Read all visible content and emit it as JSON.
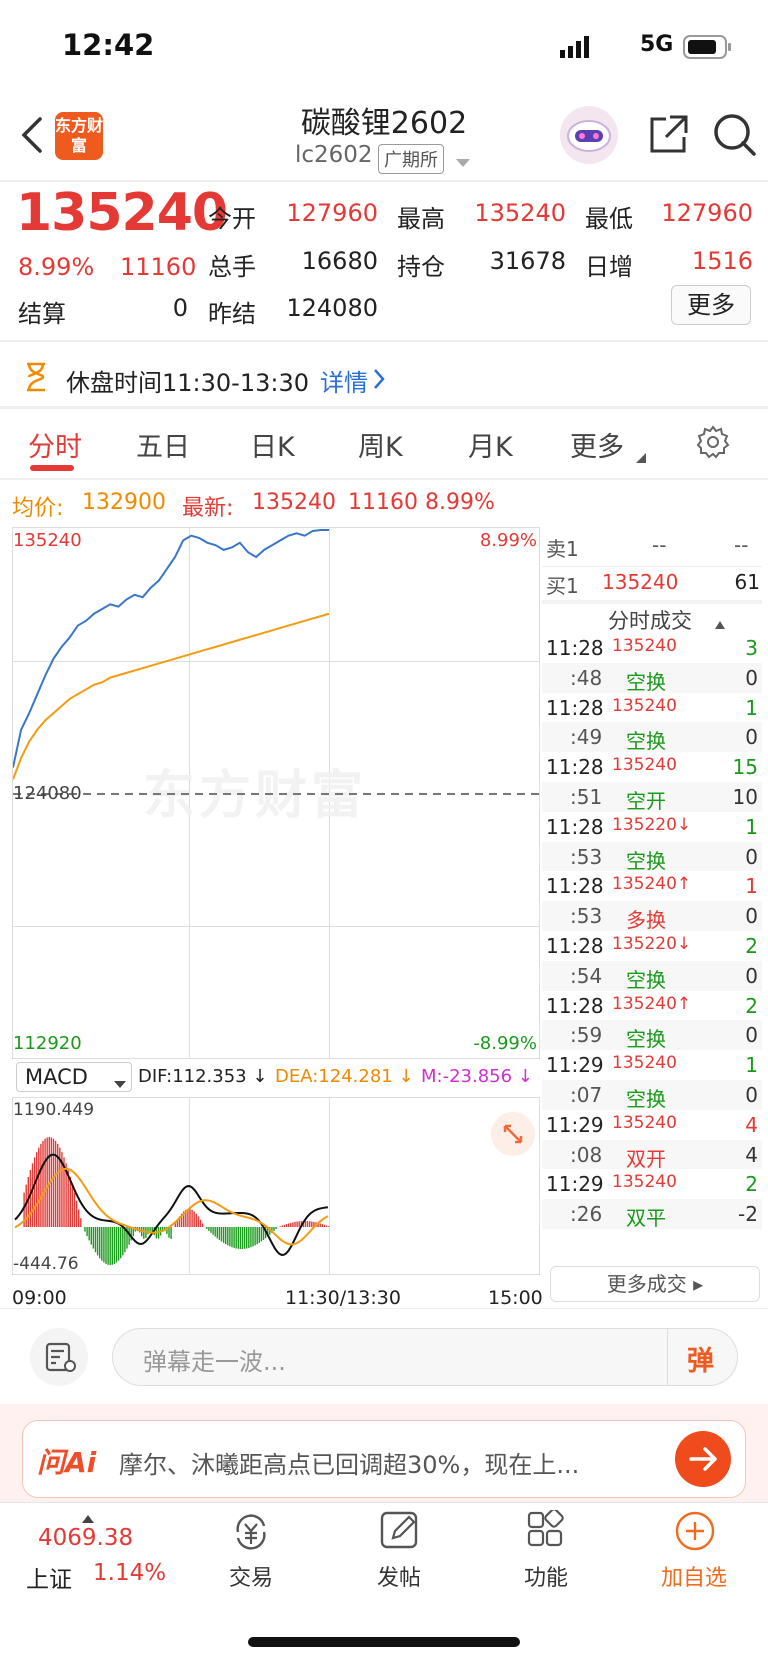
{
  "status_bar": {
    "time": "12:42",
    "network": "5G"
  },
  "header": {
    "title": "碳酸锂2602",
    "code": "lc2602",
    "exchange": "广期所",
    "logo_text": "东方财富"
  },
  "quote": {
    "last": "135240",
    "change_pct": "8.99%",
    "change": "11160",
    "labels": {
      "open": "今开",
      "high": "最高",
      "low": "最低",
      "volume": "总手",
      "oi": "持仓",
      "daily_add": "日增",
      "settle": "结算",
      "pre_settle": "昨结"
    },
    "open": "127960",
    "high": "135240",
    "low": "127960",
    "volume": "16680",
    "oi": "31678",
    "daily_add": "1516",
    "settle": "0",
    "pre_settle": "124080",
    "more": "更多"
  },
  "notice": {
    "text": "休盘时间11:30-13:30",
    "link": "详情"
  },
  "tabs": [
    "分时",
    "五日",
    "日K",
    "周K",
    "月K",
    "更多"
  ],
  "info_line": {
    "avg_label": "均价:",
    "avg": "132900",
    "last_label": "最新:",
    "last": "135240",
    "chg": "11160",
    "pct": "8.99%"
  },
  "chart_data": {
    "type": "line",
    "axis_high": "135240",
    "axis_low": "112920",
    "axis_mid": "124080",
    "pct_high": "8.99%",
    "pct_low": "-8.99%",
    "x_labels": [
      "09:00",
      "11:30/13:30",
      "15:00"
    ],
    "ylim": [
      112920,
      135240
    ],
    "series": [
      {
        "color": "#3a76c8",
        "values": [
          125200,
          126800,
          127500,
          128300,
          129100,
          129800,
          130300,
          130700,
          131200,
          131400,
          131700,
          131900,
          132100,
          132000,
          132300,
          132500,
          132400,
          132800,
          133100,
          133600,
          134100,
          134800,
          135000,
          134900,
          134700,
          134600,
          134400,
          134500,
          134700,
          134300,
          134100,
          134400,
          134600,
          134800,
          135000,
          135100,
          135000,
          135200,
          135240,
          135240
        ]
      },
      {
        "color": "#f39c12",
        "values": [
          124700,
          125600,
          126300,
          126800,
          127200,
          127500,
          127800,
          128100,
          128300,
          128500,
          128700,
          128800,
          129000,
          129100,
          129200,
          129300,
          129400,
          129500,
          129600,
          129700,
          129800,
          129900,
          130000,
          130100,
          130200,
          130300,
          130400,
          130500,
          130600,
          130700,
          130800,
          130900,
          131000,
          131100,
          131200,
          131300,
          131400,
          131500,
          131600,
          131700
        ]
      }
    ]
  },
  "macd": {
    "label": "MACD",
    "dif": "DIF:112.353 ↓",
    "dea": "DEA:124.281 ↓",
    "m": "M:-23.856 ↓",
    "top": "1190.449",
    "bottom": "-444.76"
  },
  "orderbook": {
    "sell_label": "卖1",
    "sell_price": "--",
    "sell_vol": "--",
    "buy_label": "买1",
    "buy_price": "135240",
    "buy_vol": "61"
  },
  "ticks_title": "分时成交",
  "ticks": [
    {
      "t": "11:28",
      "p": "135240",
      "v": "3",
      "pc": "red",
      "vc": "green"
    },
    {
      "t": ":48",
      "p": "空换",
      "v": "0",
      "pc": "green",
      "vc": "gray"
    },
    {
      "t": "11:28",
      "p": "135240",
      "v": "1",
      "pc": "red",
      "vc": "green"
    },
    {
      "t": ":49",
      "p": "空换",
      "v": "0",
      "pc": "green",
      "vc": "gray"
    },
    {
      "t": "11:28",
      "p": "135240",
      "v": "15",
      "pc": "red",
      "vc": "green"
    },
    {
      "t": ":51",
      "p": "空开",
      "v": "10",
      "pc": "green",
      "vc": "gray"
    },
    {
      "t": "11:28",
      "p": "135220↓",
      "v": "1",
      "pc": "red",
      "vc": "green"
    },
    {
      "t": ":53",
      "p": "空换",
      "v": "0",
      "pc": "green",
      "vc": "gray"
    },
    {
      "t": "11:28",
      "p": "135240↑",
      "v": "1",
      "pc": "red",
      "vc": "red"
    },
    {
      "t": ":53",
      "p": "多换",
      "v": "0",
      "pc": "red",
      "vc": "gray"
    },
    {
      "t": "11:28",
      "p": "135220↓",
      "v": "2",
      "pc": "red",
      "vc": "green"
    },
    {
      "t": ":54",
      "p": "空换",
      "v": "0",
      "pc": "green",
      "vc": "gray"
    },
    {
      "t": "11:28",
      "p": "135240↑",
      "v": "2",
      "pc": "red",
      "vc": "green"
    },
    {
      "t": ":59",
      "p": "空换",
      "v": "0",
      "pc": "green",
      "vc": "gray"
    },
    {
      "t": "11:29",
      "p": "135240",
      "v": "1",
      "pc": "red",
      "vc": "green"
    },
    {
      "t": ":07",
      "p": "空换",
      "v": "0",
      "pc": "green",
      "vc": "gray"
    },
    {
      "t": "11:29",
      "p": "135240",
      "v": "4",
      "pc": "red",
      "vc": "red"
    },
    {
      "t": ":08",
      "p": "双开",
      "v": "4",
      "pc": "red",
      "vc": "gray"
    },
    {
      "t": "11:29",
      "p": "135240",
      "v": "2",
      "pc": "red",
      "vc": "green"
    },
    {
      "t": ":26",
      "p": "双平",
      "v": "-2",
      "pc": "green",
      "vc": "gray"
    }
  ],
  "more_ticks": "更多成交",
  "comment": {
    "placeholder": "弹幕走一波...",
    "danmu": "弹"
  },
  "ai": {
    "logo": "问Ai",
    "text": "摩尔、沐曦距高点已回调超30%，现在上..."
  },
  "bottom": {
    "index_value": "4069.38",
    "index_name": "上证",
    "index_pct": "1.14%",
    "trade": "交易",
    "post": "发帖",
    "func": "功能",
    "watch": "加自选"
  }
}
